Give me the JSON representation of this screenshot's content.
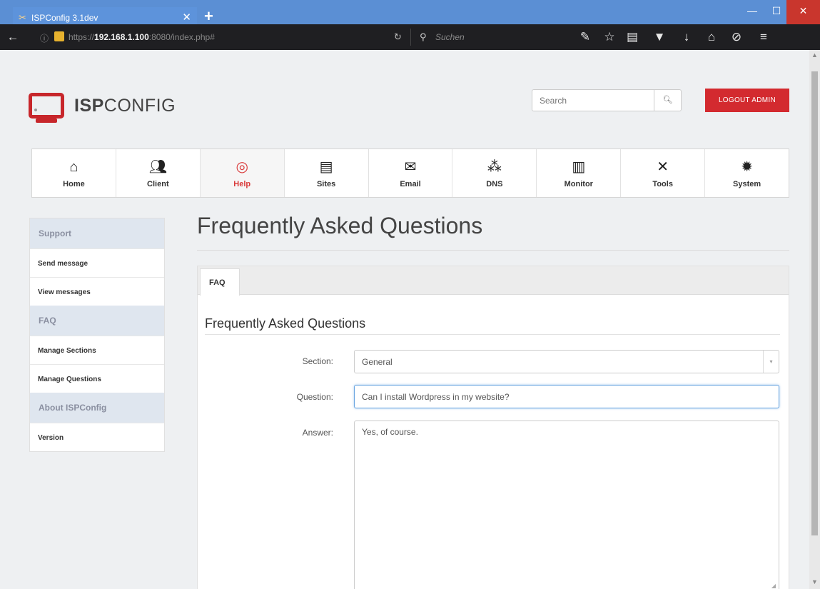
{
  "browser": {
    "tab_title": "ISPConfig 3.1dev",
    "url_prefix": "https://",
    "url_host": "192.168.1.100",
    "url_rest": ":8080/index.php#",
    "search_placeholder": "Suchen"
  },
  "header": {
    "brand_bold": "ISP",
    "brand_rest": "CONFIG",
    "search_placeholder": "Search",
    "logout_label": "LOGOUT ADMIN"
  },
  "mainnav": {
    "items": [
      {
        "label": "Home",
        "icon": "home-icon",
        "active": false
      },
      {
        "label": "Client",
        "icon": "client-icon",
        "active": false
      },
      {
        "label": "Help",
        "icon": "lifebuoy-icon",
        "active": true
      },
      {
        "label": "Sites",
        "icon": "sites-icon",
        "active": false
      },
      {
        "label": "Email",
        "icon": "email-icon",
        "active": false
      },
      {
        "label": "DNS",
        "icon": "dns-icon",
        "active": false
      },
      {
        "label": "Monitor",
        "icon": "monitor-icon",
        "active": false
      },
      {
        "label": "Tools",
        "icon": "tools-icon",
        "active": false
      },
      {
        "label": "System",
        "icon": "gear-icon",
        "active": false
      }
    ]
  },
  "sidebar": {
    "support_header": "Support",
    "send_message": "Send message",
    "view_messages": "View messages",
    "faq_header": "FAQ",
    "manage_sections": "Manage Sections",
    "manage_questions": "Manage Questions",
    "about_header": "About ISPConfig",
    "version": "Version"
  },
  "main": {
    "page_title": "Frequently Asked Questions",
    "tab_label": "FAQ",
    "section_heading": "Frequently Asked Questions",
    "form": {
      "section_label": "Section:",
      "section_value": "General",
      "question_label": "Question:",
      "question_value": "Can I install Wordpress in my website?",
      "answer_label": "Answer:",
      "answer_value": "Yes, of course."
    }
  },
  "colors": {
    "brand_red": "#c7262b",
    "active_nav": "#d93a3a",
    "sidebar_header_bg": "#dfe6ef",
    "window_titlebar": "#5b8fd4"
  }
}
